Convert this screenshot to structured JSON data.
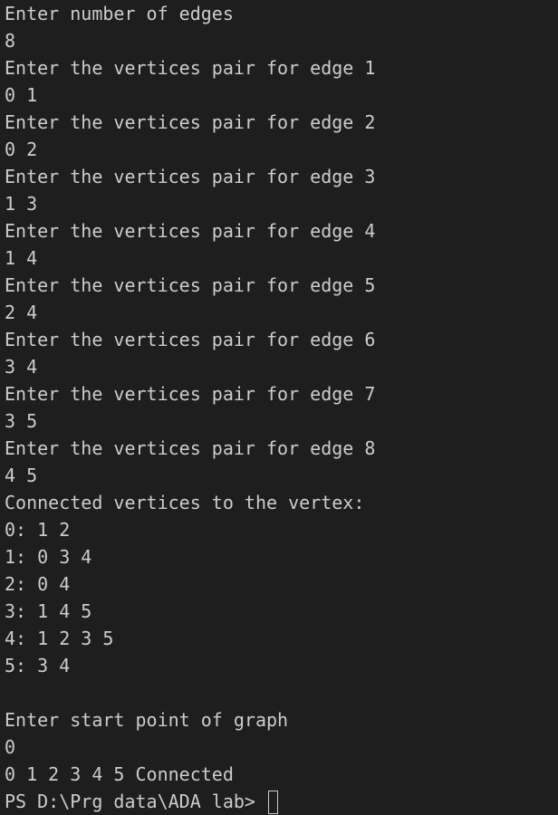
{
  "terminal": {
    "lines": [
      "Enter number of edges",
      "8",
      "Enter the vertices pair for edge 1",
      "0 1",
      "Enter the vertices pair for edge 2",
      "0 2",
      "Enter the vertices pair for edge 3",
      "1 3",
      "Enter the vertices pair for edge 4",
      "1 4",
      "Enter the vertices pair for edge 5",
      "2 4",
      "Enter the vertices pair for edge 6",
      "3 4",
      "Enter the vertices pair for edge 7",
      "3 5",
      "Enter the vertices pair for edge 8",
      "4 5",
      "Connected vertices to the vertex:",
      "0: 1 2",
      "1: 0 3 4",
      "2: 0 4",
      "3: 1 4 5",
      "4: 1 2 3 5",
      "5: 3 4",
      "",
      "Enter start point of graph",
      "0",
      "0 1 2 3 4 5 Connected"
    ],
    "prompt": "PS D:\\Prg data\\ADA lab> ",
    "colors": {
      "background": "#1e1e1e",
      "text": "#cccccc"
    }
  }
}
